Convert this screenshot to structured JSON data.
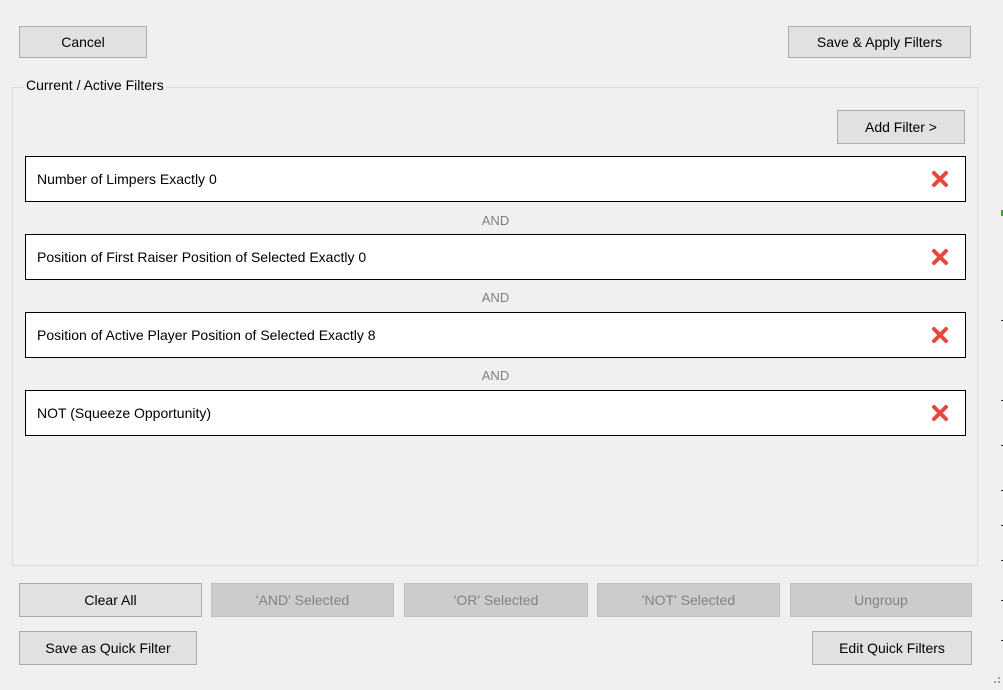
{
  "dialog": {
    "cancel_label": "Cancel",
    "save_apply_label": "Save & Apply Filters",
    "group_title": "Current / Active Filters",
    "add_filter_label": "Add Filter >"
  },
  "filters": [
    {
      "text": "Number of Limpers Exactly 0"
    },
    {
      "text": "Position of First Raiser Position of Selected Exactly 0"
    },
    {
      "text": "Position of Active Player Position of Selected Exactly 8"
    },
    {
      "text": "NOT (Squeeze Opportunity)"
    }
  ],
  "connectors": [
    "AND",
    "AND",
    "AND"
  ],
  "bottom": {
    "clear_all_label": "Clear All",
    "and_selected_label": "'AND' Selected",
    "or_selected_label": "'OR' Selected",
    "not_selected_label": "'NOT' Selected",
    "ungroup_label": "Ungroup",
    "save_quick_label": "Save as Quick Filter",
    "edit_quick_label": "Edit Quick Filters"
  },
  "colors": {
    "delete_icon": "#e8473c",
    "background": "#f0f0f0",
    "button": "#e1e1e1",
    "disabled_button": "#cccccc",
    "disabled_text": "#838383"
  },
  "icons": {
    "delete": "close-x-icon",
    "resize": "resize-grip-icon"
  }
}
